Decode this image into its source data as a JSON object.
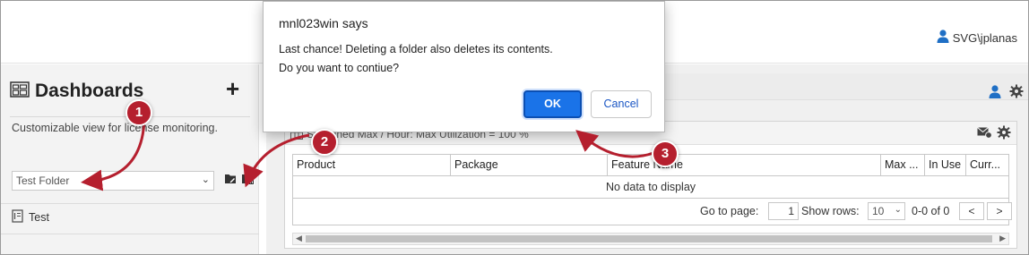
{
  "header": {
    "user": "SVG\\jplanas",
    "user_icon": "user-icon"
  },
  "sidebar": {
    "title": "Dashboards",
    "title_icon": "dashboard-icon",
    "add_label": "+",
    "description": "Customizable view for license monitoring.",
    "folder_select_value": "Test Folder",
    "folder_icons": [
      "folder-edit-icon",
      "folder-delete-icon"
    ],
    "items": [
      {
        "label": "Test",
        "icon": "dashboard-page-icon"
      }
    ]
  },
  "widget": {
    "title": "Sustained Max / Hour: Max Utilization = 100 %",
    "columns": [
      "Product",
      "Package",
      "Feature Name",
      "Max ...",
      "In Use",
      "Curr..."
    ],
    "empty_text": "No data to display",
    "pager": {
      "goto_label": "Go to page:",
      "page_value": "1",
      "show_rows_label": "Show rows:",
      "rows_value": "10",
      "range_text": "0-0 of 0",
      "prev_label": "<",
      "next_label": ">"
    }
  },
  "dialog": {
    "title": "mnl023win says",
    "message_line1": "Last chance! Deleting a folder also deletes its contents.",
    "message_line2": "Do you want to contiue?",
    "ok_label": "OK",
    "cancel_label": "Cancel"
  },
  "annotations": {
    "steps": [
      "1",
      "2",
      "3"
    ],
    "color": "#b51f2e"
  }
}
